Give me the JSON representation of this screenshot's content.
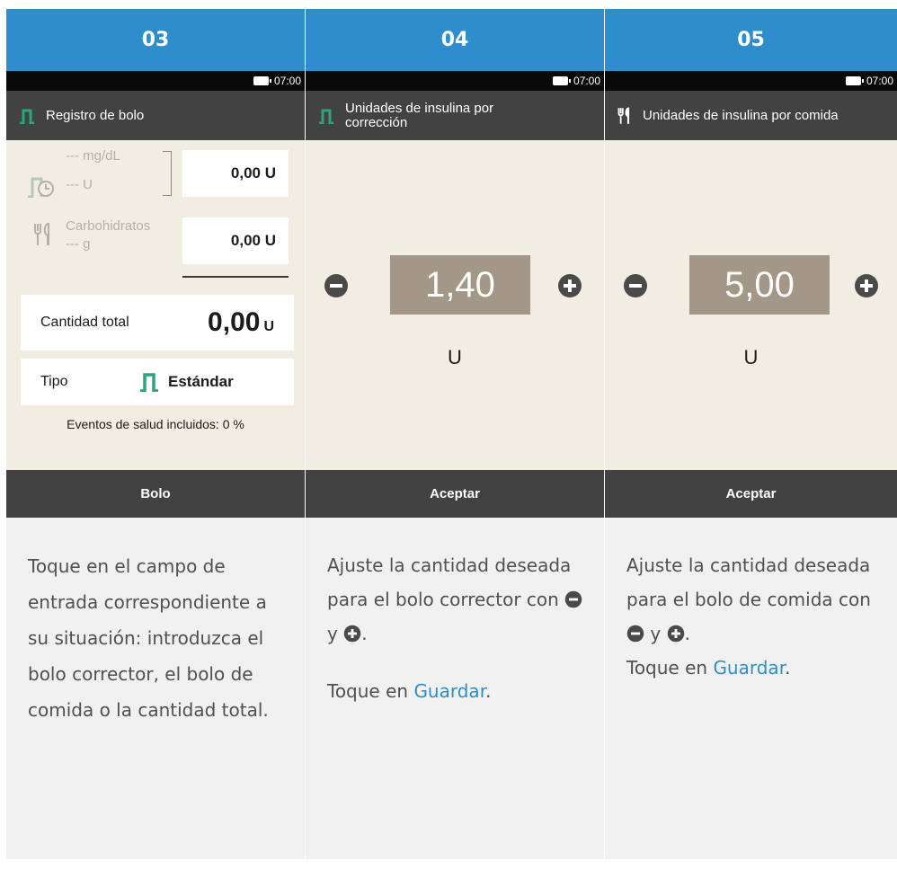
{
  "steps": [
    {
      "number": "03",
      "status_time": "07:00",
      "title": "Registro de bolo",
      "corr_mg": "--- mg/dL",
      "corr_u": "--- U",
      "corr_value": "0,00 U",
      "carb_label": "Carbohidratos",
      "carb_g": "--- g",
      "carb_value": "0,00 U",
      "total_label": "Cantidad total",
      "total_value": "0,00",
      "total_unit": "U",
      "tipo_label": "Tipo",
      "tipo_value": "Estándar",
      "eventos": "Eventos de salud incluidos: 0 %",
      "action": "Bolo",
      "desc": "Toque en el campo de entrada correspondiente a su situación: introduzca el bolo corrector, el bolo de comida o la cantidad total."
    },
    {
      "number": "04",
      "status_time": "07:00",
      "title": "Unidades de insulina por corrección",
      "value": "1,40",
      "unit": "U",
      "action": "Aceptar",
      "desc_a": "Ajuste la cantidad deseada para el bolo corrector con",
      "desc_y": "y",
      "desc_end": ".",
      "desc_b_pre": "Toque en",
      "desc_b_link": "Guardar",
      "desc_b_end": "."
    },
    {
      "number": "05",
      "status_time": "07:00",
      "title": "Unidades de insulina por comida",
      "value": "5,00",
      "unit": "U",
      "action": "Aceptar",
      "desc_a": "Ajuste la cantidad deseada para el bolo de comida con",
      "desc_y": "y",
      "desc_end": ".",
      "desc_b_pre": "Toque en",
      "desc_b_link": "Guardar",
      "desc_b_end": "."
    }
  ],
  "colors": {
    "header_blue": "#2e8ecb",
    "bolus_green": "#2aa67a",
    "value_box": "#a39888",
    "screen_bg": "#f1ede2",
    "bar_dark": "#424242"
  },
  "icons": [
    "bolus-standard-icon",
    "bolus-clock-icon",
    "fork-knife-icon",
    "minus-circle-icon",
    "plus-circle-icon",
    "battery-icon"
  ]
}
